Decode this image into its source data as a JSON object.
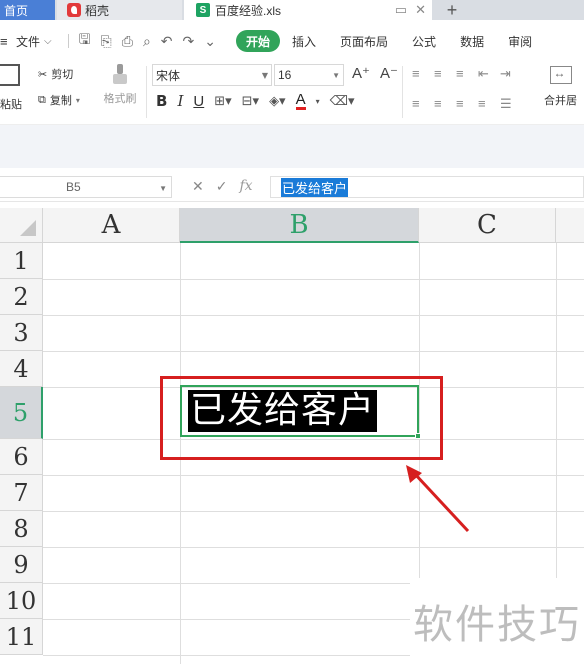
{
  "tabs": {
    "home": "首页",
    "daoke": "稻壳",
    "file": "百度经验.xls",
    "file_icon": "S"
  },
  "menu": {
    "file_label": "文件",
    "items": [
      "开始",
      "插入",
      "页面布局",
      "公式",
      "数据",
      "审阅"
    ],
    "active_index": 0,
    "active_color": "#31a45a"
  },
  "ribbon": {
    "paste": "粘贴",
    "cut": "剪切",
    "copy": "复制",
    "format_painter": "格式刷",
    "font_name": "宋体",
    "font_size": "16",
    "merge": "合并居"
  },
  "formula_bar": {
    "cell_ref": "B5",
    "content": "已发给客户"
  },
  "grid": {
    "columns": [
      "A",
      "B",
      "C"
    ],
    "active_column": "B",
    "rows": [
      "1",
      "2",
      "3",
      "4",
      "5",
      "6",
      "7",
      "8",
      "9",
      "10",
      "11"
    ],
    "active_row": "5",
    "active_cell": "B5",
    "active_cell_text": "已发给客户",
    "selection_color": "#31a45a",
    "annotation_color": "#d61f1f"
  },
  "watermark": "软件技巧"
}
